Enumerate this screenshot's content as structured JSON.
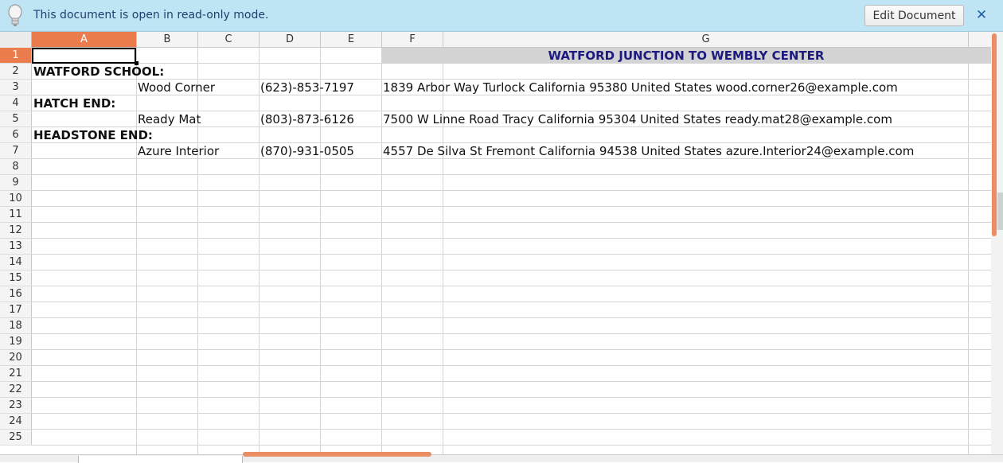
{
  "infobar": {
    "message": "This document is open in read-only mode.",
    "edit_button": "Edit Document",
    "close_glyph": "✕"
  },
  "columns": [
    "A",
    "B",
    "C",
    "D",
    "E",
    "F",
    "G"
  ],
  "rows": [
    "1",
    "2",
    "3",
    "4",
    "5",
    "6",
    "7",
    "8",
    "9",
    "10",
    "11",
    "12",
    "13",
    "14",
    "15",
    "16",
    "17",
    "18",
    "19",
    "20",
    "21",
    "22",
    "23",
    "24",
    "25"
  ],
  "cells": {
    "g1": "WATFORD JUNCTION TO WEMBLY CENTER",
    "a2": "WATFORD SCHOOL:",
    "b3": "Wood Corner",
    "d3": "(623)-853-7197",
    "f3": "1839 Arbor Way  Turlock California 95380 United States wood.corner26@example.com",
    "a4": "HATCH END:",
    "b5": "Ready Mat",
    "d5": "(803)-873-6126",
    "f5": "7500 W Linne Road  Tracy California 95304 United States ready.mat28@example.com",
    "a6": "HEADSTONE END:",
    "b7": "Azure Interior",
    "d7": "(870)-931-0505",
    "f7": "4557 De Silva St  Fremont California 94538 United States azure.Interior24@example.com"
  },
  "colors": {
    "infobar_bg": "#bfe4f4",
    "active_header": "#ea7c4d",
    "banner_bg": "#d3d3d3",
    "banner_text": "#1c1a7e"
  },
  "icons": {
    "infobar": "lightbulb-icon",
    "close": "close-icon"
  }
}
